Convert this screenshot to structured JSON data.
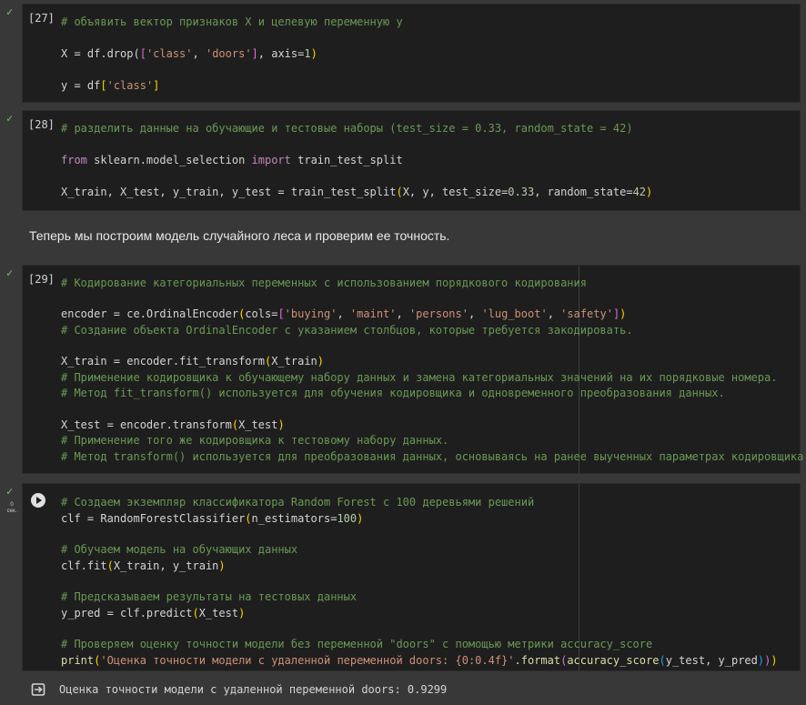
{
  "cells": [
    {
      "exec_label": "[27]",
      "lines": {
        "l1": "# объявить вектор признаков X и целевую переменную y",
        "l2a": "X = df.drop(",
        "l2b": "[",
        "l2c": "'class'",
        "l2d": ", ",
        "l2e": "'doors'",
        "l2f": "]",
        "l2g": ", axis=",
        "l2h": "1",
        "l2i": ")",
        "l3a": "y = df",
        "l3b": "[",
        "l3c": "'class'",
        "l3d": "]"
      }
    },
    {
      "exec_label": "[28]",
      "lines": {
        "l1": "# разделить данные на обучающие и тестовые наборы (test_size = 0.33, random_state = 42)",
        "l2a": "from",
        "l2b": " sklearn.model_selection ",
        "l2c": "import",
        "l2d": " train_test_split",
        "l3a": "X_train, X_test, y_train, y_test = train_test_split",
        "l3b": "(",
        "l3c": "X, y, test_size=",
        "l3d": "0.33",
        "l3e": ", random_state=",
        "l3f": "42",
        "l3g": ")"
      }
    },
    {
      "exec_label": "[29]",
      "lines": {
        "l1": "# Кодирование категориальных переменных с использованием порядкового кодирования",
        "l2a": "encoder = ce.OrdinalEncoder",
        "l2b": "(",
        "l2c": "cols=",
        "l2d": "[",
        "l2e": "'buying'",
        "l2f": ", ",
        "l2g": "'maint'",
        "l2h": ", ",
        "l2i": "'persons'",
        "l2j": ", ",
        "l2k": "'lug_boot'",
        "l2l": ", ",
        "l2m": "'safety'",
        "l2n": "]",
        "l2o": ")",
        "l3": "# Создание объекта OrdinalEncoder с указанием столбцов, которые требуется закодировать.",
        "l4a": "X_train = encoder.fit_transform",
        "l4b": "(",
        "l4c": "X_train",
        "l4d": ")",
        "l5": "# Применение кодировщика к обучающему набору данных и замена категориальных значений на их порядковые номера.",
        "l6": "# Метод fit_transform() используется для обучения кодировщика и одновременного преобразования данных.",
        "l7a": "X_test = encoder.transform",
        "l7b": "(",
        "l7c": "X_test",
        "l7d": ")",
        "l8": "# Применение того же кодировщика к тестовому набору данных.",
        "l9": "# Метод transform() используется для преобразования данных, основываясь на ранее выученных параметрах кодировщика."
      }
    },
    {
      "time_label_1": "0",
      "time_label_2": "сек.",
      "lines": {
        "l1": "# Создаем экземпляр классификатора Random Forest с 100 деревьями решений",
        "l2a": "clf = RandomForestClassifier",
        "l2b": "(",
        "l2c": "n_estimators=",
        "l2d": "100",
        "l2e": ")",
        "l3": "# Обучаем модель на обучающих данных",
        "l4a": "clf.fit",
        "l4b": "(",
        "l4c": "X_train, y_train",
        "l4d": ")",
        "l5": "# Предсказываем результаты на тестовых данных",
        "l6a": "y_pred = clf.predict",
        "l6b": "(",
        "l6c": "X_test",
        "l6d": ")",
        "l7": "# Проверяем оценку точности модели без переменной \"doors\" с помощью метрики accuracy_score",
        "l8a": "print",
        "l8b": "(",
        "l8c": "'Оценка точности модели с удаленной переменной doors: {0:0.4f}'",
        "l8d": ".format",
        "l8e": "(",
        "l8f": "accuracy_score",
        "l8g": "(",
        "l8h": "y_test, y_pred",
        "l8i": ")",
        "l8j": ")",
        "l8k": ")"
      }
    }
  ],
  "markdown_text": "Теперь мы построим модель случайного леса и проверим ее точность.",
  "output_text": "Оценка точности модели с удаленной переменной doors: 0.9299",
  "colors": {
    "comment": "#6a9955",
    "keyword": "#c586c0",
    "string": "#ce9178",
    "number": "#b5cea8",
    "check": "#6ecb63"
  },
  "icons": {
    "run": "play-circle-icon",
    "done": "checkmark-icon",
    "output": "output-arrow-icon"
  }
}
